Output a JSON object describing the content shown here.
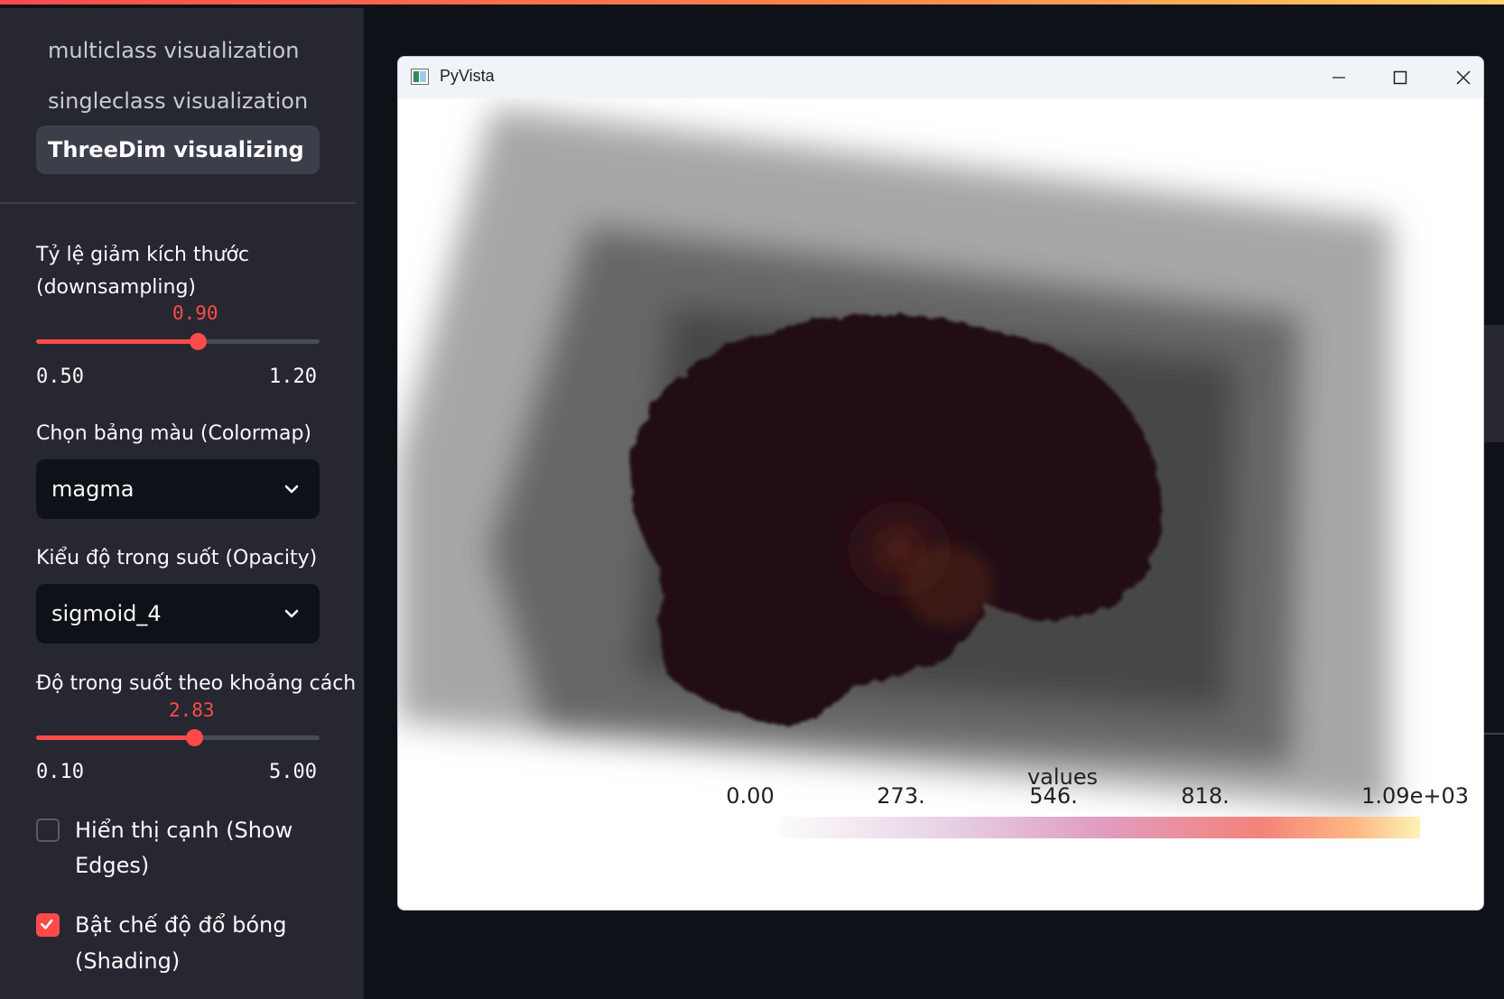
{
  "sidebar": {
    "nav": [
      {
        "label": "multiclass visualization"
      },
      {
        "label": "singleclass visualization"
      },
      {
        "label": "ThreeDim visualizing"
      }
    ],
    "downsampling": {
      "label_line1": "Tỷ lệ giảm kích thước",
      "label_line2": "(downsampling)",
      "value": "0.90",
      "min": "0.50",
      "max": "1.20",
      "fraction": 0.571
    },
    "colormap": {
      "label": "Chọn bảng màu (Colormap)",
      "selected": "magma"
    },
    "opacity": {
      "label": "Kiểu độ trong suốt (Opacity)",
      "selected": "sigmoid_4"
    },
    "distance_opacity": {
      "label": "Độ trong suốt theo khoảng cách",
      "value": "2.83",
      "min": "0.10",
      "max": "5.00",
      "fraction": 0.557
    },
    "show_edges": {
      "label_line1": "Hiển thị cạnh (Show",
      "label_line2": "Edges)",
      "checked": false
    },
    "shading": {
      "label_line1": "Bật chế độ đổ bóng",
      "label_line2": "(Shading)",
      "checked": true
    }
  },
  "viewer": {
    "window_title": "PyVista",
    "scalar_bar": {
      "title": "values",
      "ticks": [
        "0.00",
        "273.",
        "546.",
        "818.",
        "1.09e+03"
      ]
    }
  },
  "colors": {
    "accent": "#ff4b4b",
    "sidebar_bg": "#262730",
    "app_bg": "#0e1117"
  }
}
